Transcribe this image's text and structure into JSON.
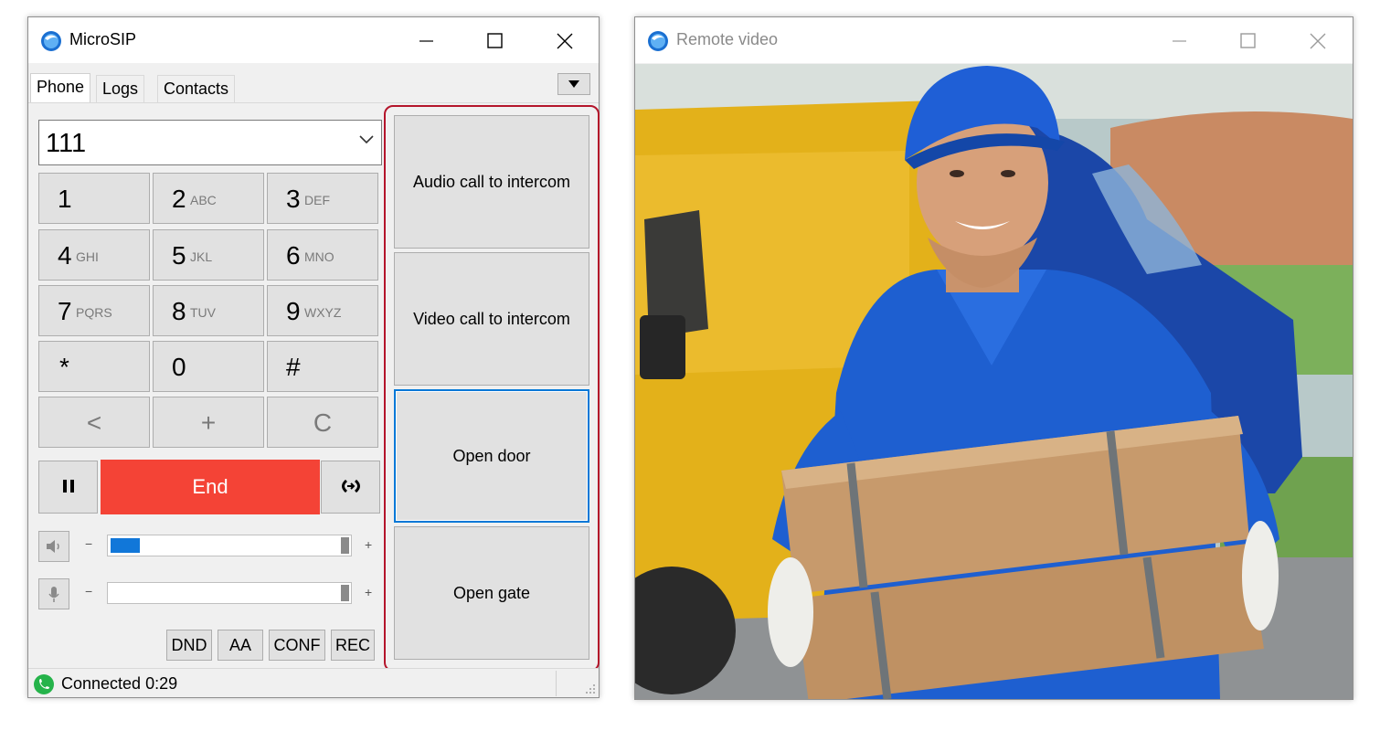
{
  "microsip": {
    "title": "MicroSIP",
    "tabs": [
      {
        "label": "Phone",
        "active": true
      },
      {
        "label": "Logs",
        "active": false
      },
      {
        "label": "Contacts",
        "active": false
      }
    ],
    "number_value": "111",
    "keypad": [
      {
        "digit": "1",
        "letters": ""
      },
      {
        "digit": "2",
        "letters": "ABC"
      },
      {
        "digit": "3",
        "letters": "DEF"
      },
      {
        "digit": "4",
        "letters": "GHI"
      },
      {
        "digit": "5",
        "letters": "JKL"
      },
      {
        "digit": "6",
        "letters": "MNO"
      },
      {
        "digit": "7",
        "letters": "PQRS"
      },
      {
        "digit": "8",
        "letters": "TUV"
      },
      {
        "digit": "9",
        "letters": "WXYZ"
      },
      {
        "digit": "*",
        "letters": ""
      },
      {
        "digit": "0",
        "letters": ""
      },
      {
        "digit": "#",
        "letters": ""
      }
    ],
    "edit_keys": {
      "backspace": "<",
      "plus": "+",
      "clear": "C"
    },
    "end_label": "End",
    "speaker_volume": 0.13,
    "mic_volume": 0.0,
    "minus_sign": "−",
    "plus_sign": "+",
    "flags": [
      "DND",
      "AA",
      "CONF",
      "REC"
    ],
    "status_text": "Connected 0:29",
    "intercom_buttons": [
      "Audio call to intercom",
      "Video call to intercom",
      "Open door",
      "Open gate"
    ],
    "colors": {
      "end": "#f44336",
      "accent": "#0078d7",
      "frame": "#b4152b",
      "connected": "#25b34a"
    }
  },
  "remote": {
    "title": "Remote video"
  }
}
